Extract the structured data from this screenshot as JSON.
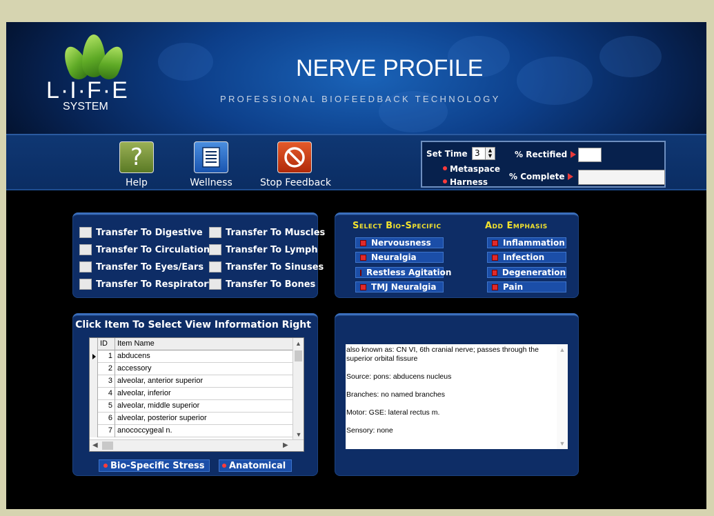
{
  "header": {
    "logo_main": "L·I·F·E",
    "logo_sub": "SYSTEM",
    "title": "NERVE PROFILE",
    "subtitle": "PROFESSIONAL BIOFEEDBACK TECHNOLOGY"
  },
  "toolbar": {
    "help_label": "Help",
    "wellness_label": "Wellness",
    "stop_label": "Stop Feedback",
    "help_glyph": "?"
  },
  "status": {
    "set_time_label": "Set Time",
    "set_time_value": "3",
    "rectified_label": "% Rectified",
    "complete_label": "% Complete",
    "metaspace_label": "Metaspace",
    "harness_label": "Harness"
  },
  "transfer": {
    "items": [
      "Transfer To Digestive",
      "Transfer To Circulation",
      "Transfer To Eyes/Ears",
      "Transfer To Respiratory",
      "Transfer To Muscles",
      "Transfer To Lymph",
      "Transfer To Sinuses",
      "Transfer To Bones"
    ]
  },
  "bio_specific": {
    "title": "Select Bio-Specific",
    "items": [
      "Nervousness",
      "Neuralgia",
      "Restless Agitation",
      "TMJ Neuralgia"
    ]
  },
  "emphasis": {
    "title": "Add Emphasis",
    "items": [
      "Inflammation",
      "Infection",
      "Degeneration",
      "Pain"
    ]
  },
  "list": {
    "title": "Click Item To Select View Information Right",
    "columns": [
      "ID",
      "Item Name"
    ],
    "rows": [
      {
        "id": "1",
        "name": "abducens"
      },
      {
        "id": "2",
        "name": "accessory"
      },
      {
        "id": "3",
        "name": "alveolar, anterior superior"
      },
      {
        "id": "4",
        "name": "alveolar, inferior"
      },
      {
        "id": "5",
        "name": "alveolar, middle superior"
      },
      {
        "id": "6",
        "name": "alveolar, posterior superior"
      },
      {
        "id": "7",
        "name": "anococcygeal n."
      }
    ],
    "mode_bio_label": "Bio-Specific Stress",
    "mode_anat_label": "Anatomical"
  },
  "info": {
    "lines": [
      "also known as: CN VI, 6th cranial nerve; passes through the superior orbital fissure",
      "Source: pons: abducens nucleus",
      "Branches: no named branches",
      "Motor: GSE: lateral rectus m.",
      "Sensory: none"
    ]
  }
}
